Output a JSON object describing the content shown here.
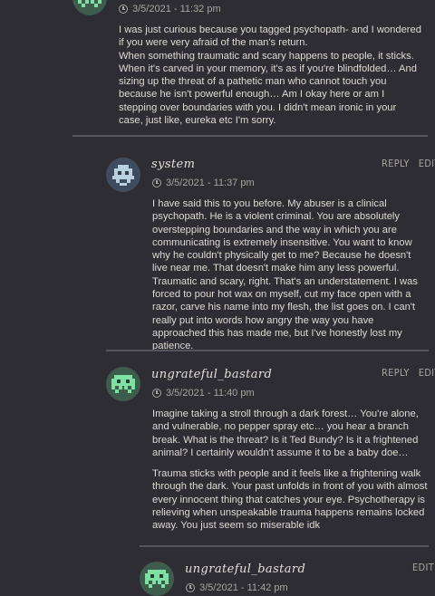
{
  "comments": [
    {
      "author": "",
      "timestamp": "3/5/2021 - 11:32 pm",
      "paragraphs": [
        "I was just curious because you tagged psychopath- and I wondered if you were very afraid of the man's return.",
        "When something traumatic and scary happens to people, it sticks. When it's carved in your memory, it's as if you're blindfolded… And sizing up the threat of a pathetic man who cannot touch you because he isn't powerful enough… Am I okay here or am I stepping over boundaries with you. I didn't mean ironic in your case, just like, eureka etc I'm sorry."
      ]
    },
    {
      "author": "system",
      "timestamp": "3/5/2021 - 11:37 pm",
      "reply_label": "REPLY",
      "edit_label": "EDIT",
      "paragraphs": [
        "I have said this to you before. My abuser is a clinical psychopath. He is a violent criminal. You are absolutely overstepping boundaries and the way in which you are communicating is extremely insensitive. You want to know why he couldn't physically get to me? Because he doesn't live near me. That doesn't make him any less powerful. Traumatic and scary, right. That's an understatement. I was forced to pour hot wax on myself, cut my face open with a razor, carve his name into my flesh, the list goes on. I can't really put into words how angry the way you have approached this has made me, but I've honestly lost my patience."
      ]
    },
    {
      "author": "ungrateful_bastard",
      "timestamp": "3/5/2021 - 11:40 pm",
      "reply_label": "REPLY",
      "edit_label": "EDIT",
      "paragraphs": [
        "Imagine taking a stroll through a dark forest… You're alone, and vulnerable, no pepper spray etc… you hear a branch break. What is the threat? Is it Ted Bundy? Is it a frightened animal? I certainly wouldn't assume it to be a baby doe…",
        "Trauma sticks with people and it feels like a frightening walk through the dark. Your past unfolds in front of you with almost every innocent thing that catches your eye. Psychotherapy is relieving when unspeakable trauma happens remains locked away. You just seem so miserable idk"
      ]
    },
    {
      "author": "ungrateful_bastard",
      "timestamp": "3/5/2021 - 11:42 pm",
      "edit_label": "EDIT",
      "paragraphs": []
    }
  ],
  "colors": {
    "background": "#2e2d33",
    "divider": "#55545c",
    "avatar_system_bg": "#3f4c5f",
    "avatar_system_fg": "#b9d0e0",
    "avatar_ungrateful_bg": "#3d5c4c",
    "avatar_ungrateful_fg": "#7fe0a4"
  },
  "icons": {
    "clock": "clock-icon",
    "avatar": "pixel-invader-avatar"
  }
}
